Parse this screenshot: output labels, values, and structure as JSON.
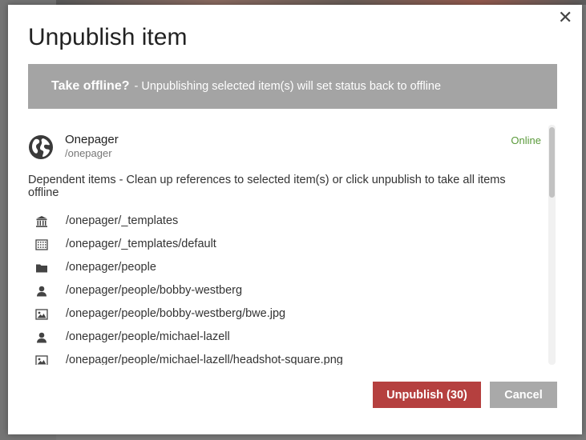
{
  "modal": {
    "title": "Unpublish item",
    "close_icon": "close-icon"
  },
  "banner": {
    "heading": "Take offline?",
    "text": "- Unpublishing selected item(s) will set status back to offline"
  },
  "main_item": {
    "icon": "globe-icon",
    "name": "Onepager",
    "path": "/onepager",
    "status": "Online",
    "status_color": "#5a9a3a"
  },
  "dependent": {
    "note": "Dependent items - Clean up references to selected item(s) or click unpublish to take all items offline",
    "items": [
      {
        "icon": "bank-icon",
        "path": "/onepager/_templates"
      },
      {
        "icon": "template-grid-icon",
        "path": "/onepager/_templates/default"
      },
      {
        "icon": "folder-icon",
        "path": "/onepager/people"
      },
      {
        "icon": "person-icon",
        "path": "/onepager/people/bobby-westberg"
      },
      {
        "icon": "image-icon",
        "path": "/onepager/people/bobby-westberg/bwe.jpg"
      },
      {
        "icon": "person-icon",
        "path": "/onepager/people/michael-lazell"
      },
      {
        "icon": "image-icon",
        "path": "/onepager/people/michael-lazell/headshot-square.png"
      }
    ]
  },
  "footer": {
    "primary_label": "Unpublish (30)",
    "primary_color": "#b5403f",
    "secondary_label": "Cancel",
    "secondary_color": "#a9a9a9"
  }
}
